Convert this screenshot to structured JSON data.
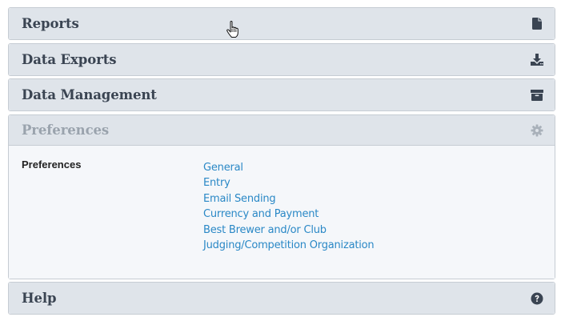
{
  "panels": {
    "reports": {
      "title": "Reports",
      "icon": "file-icon"
    },
    "exports": {
      "title": "Data Exports",
      "icon": "download-icon"
    },
    "management": {
      "title": "Data Management",
      "icon": "archive-icon"
    },
    "preferences": {
      "title": "Preferences",
      "icon": "gear-icon",
      "body_label": "Preferences",
      "links": [
        "General",
        "Entry",
        "Email Sending",
        "Currency and Payment",
        "Best Brewer and/or Club",
        "Judging/Competition Organization"
      ]
    },
    "help": {
      "title": "Help",
      "icon": "question-circle-icon"
    }
  },
  "colors": {
    "heading_bg": "#dfe4ea",
    "title_text": "#3a4452",
    "title_text_active": "#9aa3ad",
    "link": "#2a88c6",
    "icon": "#3a4452",
    "icon_active": "#a9b1ba"
  }
}
